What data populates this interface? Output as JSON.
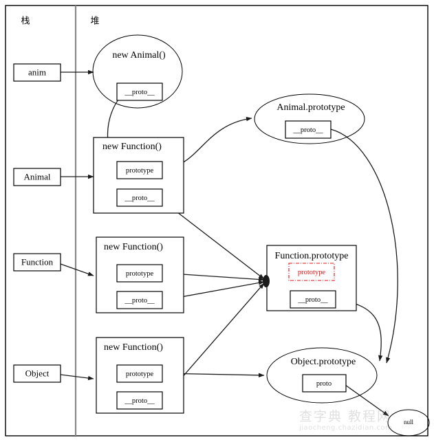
{
  "diagram": {
    "title_columns": {
      "stack": "栈",
      "heap": "堆"
    },
    "stack_items": [
      {
        "label": "anim"
      },
      {
        "label": "Animal"
      },
      {
        "label": "Function"
      },
      {
        "label": "Object"
      }
    ],
    "heap_objects": [
      {
        "id": "new-animal",
        "title": "new Animal()",
        "shape": "ellipse",
        "slots": [
          {
            "label": "__proto__"
          }
        ]
      },
      {
        "id": "animal-function",
        "title": "new Function()",
        "shape": "rect",
        "slots": [
          {
            "label": "prototype"
          },
          {
            "label": "__proto__"
          }
        ]
      },
      {
        "id": "function-function",
        "title": "new Function()",
        "shape": "rect",
        "slots": [
          {
            "label": "prototype"
          },
          {
            "label": "__proto__"
          }
        ]
      },
      {
        "id": "object-function",
        "title": "new Function()",
        "shape": "rect",
        "slots": [
          {
            "label": "prototype"
          },
          {
            "label": "__proto__"
          }
        ]
      },
      {
        "id": "animal-prototype",
        "title": "Animal.prototype",
        "shape": "ellipse",
        "slots": [
          {
            "label": "__proto__"
          }
        ]
      },
      {
        "id": "function-prototype",
        "title": "Function.prototype",
        "shape": "rect",
        "slots": [
          {
            "label": "prototype",
            "style": "red-dashed"
          },
          {
            "label": "__proto__"
          }
        ]
      },
      {
        "id": "object-prototype",
        "title": "Object.prototype",
        "shape": "ellipse",
        "slots": [
          {
            "label": "proto"
          }
        ]
      },
      {
        "id": "null-node",
        "title": "null",
        "shape": "ellipse",
        "slots": []
      }
    ],
    "colors": {
      "stroke": "#000000",
      "edge": "#1a1a1a",
      "divider": "#888888",
      "highlight_red": "#ee1111",
      "background": "#ffffff"
    }
  },
  "watermark": {
    "main": "查字典 教程网",
    "sub": "jiaocheng.chazidian.com"
  }
}
